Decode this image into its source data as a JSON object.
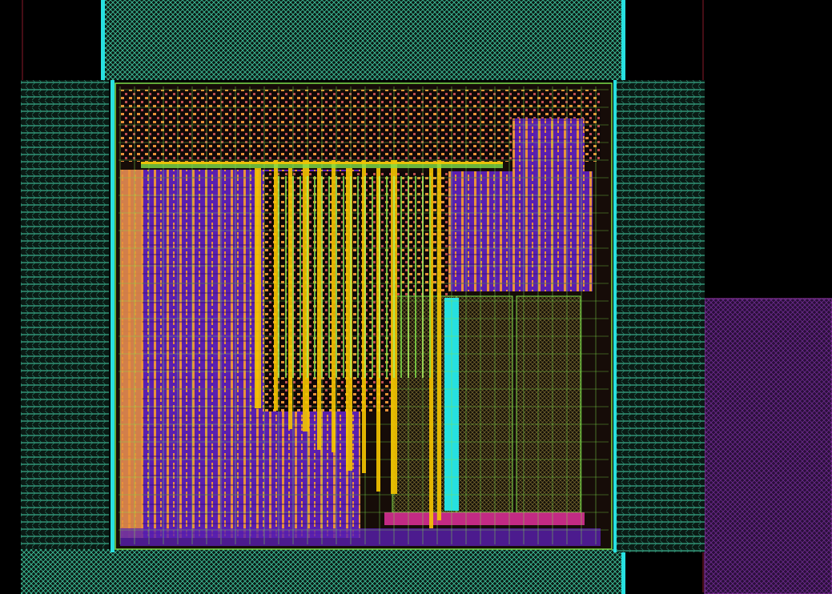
{
  "layout_viewer": {
    "colors": {
      "background": "#000000",
      "pad_mesh": "#3fbf9a",
      "power_rail": "#27e0e0",
      "metal_orange": "#e8913a",
      "poly_yellow": "#f5c400",
      "metal_green": "#7fe04a",
      "diffusion_purple": "#5a1fb0",
      "block_outline": "#c04a6a",
      "magenta_bar": "#e0309a",
      "nwell_purple": "#5a2a7a",
      "inner_dark": "#1a1010"
    },
    "layers": [
      "pad-ring",
      "power-rail",
      "standard-cell-rows",
      "metal-routing",
      "macro-block",
      "nwell-region"
    ]
  }
}
